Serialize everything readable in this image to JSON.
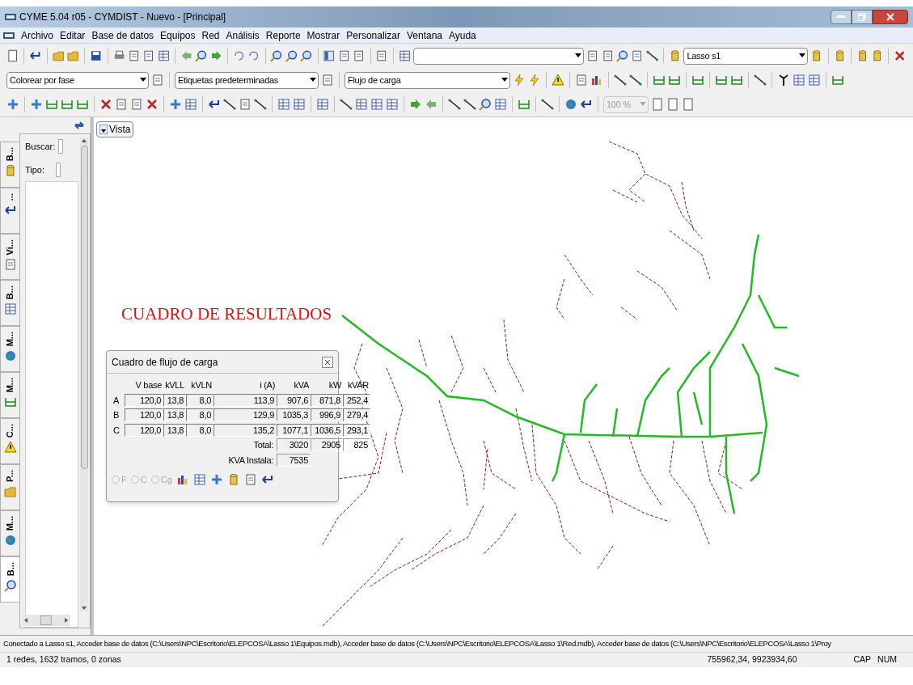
{
  "window": {
    "title": "CYME 5.04 r05 - CYMDIST - Nuevo - [Principal]"
  },
  "menu": [
    "Archivo",
    "Editar",
    "Base de datos",
    "Equipos",
    "Red",
    "Análisis",
    "Reporte",
    "Mostrar",
    "Personalizar",
    "Ventana",
    "Ayuda"
  ],
  "toolbar_1": {
    "study_combo": {
      "value": "Lasso s1"
    }
  },
  "toolbar_2": {
    "combos": [
      {
        "value": "Colorear por fase"
      },
      {
        "value": "Etiquetas predeterminadas"
      },
      {
        "value": "Flujo de carga"
      }
    ]
  },
  "toolbar_3": {
    "zoom_combo": {
      "value": "100 %",
      "disabled": true
    }
  },
  "sidebar": {
    "search_label": "Buscar:",
    "type_label": "Tipo:",
    "tabs": [
      {
        "label": "B...",
        "selected": false
      },
      {
        "label": "...",
        "selected": false
      },
      {
        "label": "Vi...",
        "selected": false
      },
      {
        "label": "B...",
        "selected": false
      },
      {
        "label": "M...",
        "selected": false
      },
      {
        "label": "M...",
        "selected": false
      },
      {
        "label": "C...",
        "selected": false
      },
      {
        "label": "P...",
        "selected": false
      },
      {
        "label": "M...",
        "selected": false
      },
      {
        "label": "B...",
        "selected": true
      }
    ]
  },
  "canvas": {
    "view_button": "Vista",
    "heading": "CUADRO DE RESULTADOS",
    "load_flow_box": {
      "title": "Cuadro de flujo de carga",
      "columns": [
        "V base",
        "kVLL",
        "kVLN",
        "i (A)",
        "kVA",
        "kW",
        "kVAR"
      ],
      "rows": [
        {
          "phase": "A",
          "cells": [
            "120,0",
            "13,8",
            "8,0",
            "113,9",
            "907,6",
            "871,8",
            "252,4"
          ]
        },
        {
          "phase": "B",
          "cells": [
            "120,0",
            "13,8",
            "8,0",
            "129,9",
            "1035,3",
            "996,9",
            "279,4"
          ]
        },
        {
          "phase": "C",
          "cells": [
            "120,0",
            "13,8",
            "8,0",
            "135,2",
            "1077,1",
            "1036,5",
            "293,1"
          ]
        }
      ],
      "total_label": "Total:",
      "totals": [
        "3020",
        "2905",
        "825"
      ],
      "installed_label": "KVA Instala:",
      "installed": "7535",
      "radios": [
        {
          "label": "F",
          "selected": false,
          "disabled": true
        },
        {
          "label": "C",
          "selected": false,
          "disabled": true
        },
        {
          "label": "Cg",
          "selected": false,
          "disabled": true
        }
      ]
    }
  },
  "status_bar": {
    "message": "Conectado a Lasso s1, Acceder base de datos (C:\\Users\\NPC\\Escritorio\\ELEPCOSA\\Lasso 1\\Equipos.mdb), Acceder base de datos (C:\\Users\\NPC\\Escritorio\\ELEPCOSA\\Lasso 1\\Red.mdb), Acceder base de datos (C:\\Users\\NPC\\Escritorio\\ELEPCOSA\\Lasso 1\\Proy",
    "summary": "1 redes, 1632 tramos, 0 zonas",
    "coordinates": "755962,34, 9923934,60",
    "caps": "CAP",
    "num": "NUM"
  }
}
